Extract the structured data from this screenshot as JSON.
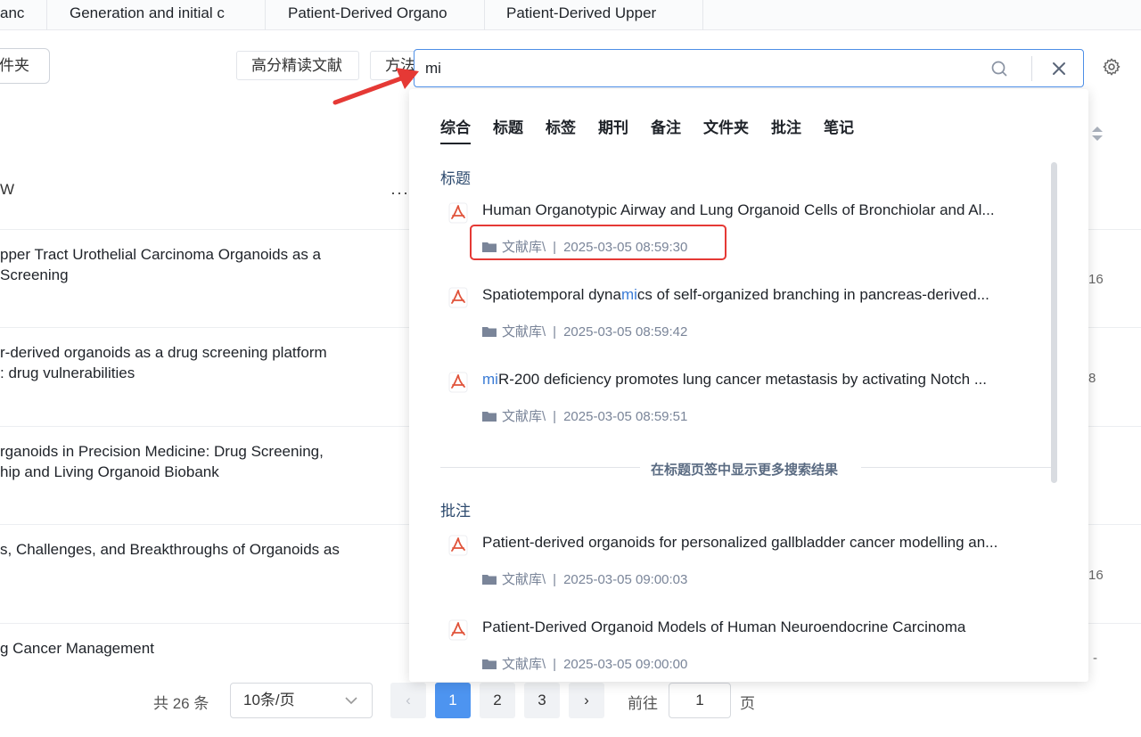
{
  "tabs": [
    {
      "label": "anc"
    },
    {
      "label": "Generation and initial c"
    },
    {
      "label": "Patient-Derived Organo"
    },
    {
      "label": "Patient-Derived Upper"
    }
  ],
  "toolbar": {
    "folder_label": "件夹",
    "chip_1": "高分精读文献",
    "chip_2": "方法"
  },
  "search": {
    "value": "mi"
  },
  "list": {
    "column_header": "W",
    "more_icon": "···",
    "rows": [
      {
        "line1": "pper Tract Urothelial Carcinoma Organoids as a",
        "line2": "Screening",
        "num": "16"
      },
      {
        "line1": "r-derived organoids as a drug screening platform",
        "line2": ": drug vulnerabilities",
        "num": "8"
      },
      {
        "line1": "rganoids in Precision Medicine: Drug Screening,",
        "line2": "hip and Living Organoid Biobank",
        "num": ""
      },
      {
        "line1": "s, Challenges, and Breakthroughs of Organoids as",
        "line2": "",
        "num": "16"
      },
      {
        "line1": "g Cancer Management",
        "line2": "",
        "num": "-"
      }
    ]
  },
  "pagination": {
    "total": "共 26 条",
    "page_size": "10条/页",
    "prev": "‹",
    "pages": [
      "1",
      "2",
      "3"
    ],
    "active_page": "1",
    "next": "›",
    "goto_label": "前往",
    "goto_value": "1",
    "goto_suffix": "页"
  },
  "dropdown": {
    "tabs": [
      "综合",
      "标题",
      "标签",
      "期刊",
      "备注",
      "文件夹",
      "批注",
      "笔记"
    ],
    "active_tab": "综合",
    "section_title": "标题",
    "title_results": [
      {
        "pre": "Human Organotypic Airway and Lung Organoid Cells of Bronchiolar and Al...",
        "hl": "",
        "post": "",
        "folder": "文献库\\",
        "sep": "|",
        "time": "2025-03-05 08:59:30"
      },
      {
        "pre": "Spatiotemporal dyna",
        "hl": "mi",
        "post": "cs of self-organized branching in pancreas-derived...",
        "folder": "文献库\\",
        "sep": "|",
        "time": "2025-03-05 08:59:42"
      },
      {
        "pre": "",
        "hl": "mi",
        "post": "R-200 deficiency promotes lung cancer metastasis by activating Notch ...",
        "folder": "文献库\\",
        "sep": "|",
        "time": "2025-03-05 08:59:51"
      }
    ],
    "more_results": "在标题页签中显示更多搜索结果",
    "section_annot": "批注",
    "annot_results": [
      {
        "pre": "Patient-derived organoids for personalized gallbladder cancer modelling an...",
        "hl": "",
        "post": "",
        "folder": "文献库\\",
        "sep": "|",
        "time": "2025-03-05 09:00:03"
      },
      {
        "pre": "Patient-Derived Organoid Models of Human Neuroendocrine Carcinoma",
        "hl": "",
        "post": "",
        "folder": "文献库\\",
        "sep": "|",
        "time": "2025-03-05 09:00:00"
      }
    ]
  },
  "colors": {
    "accent": "#4d94f0",
    "highlight": "#3a7bd5",
    "annotation_red": "#e53935"
  },
  "icons": {
    "search": "search-icon",
    "close": "close-icon",
    "gear": "gear-icon",
    "pdf": "pdf-icon",
    "folder": "folder-icon",
    "sort": "sort-icon",
    "chevron": "chevron-down-icon"
  }
}
